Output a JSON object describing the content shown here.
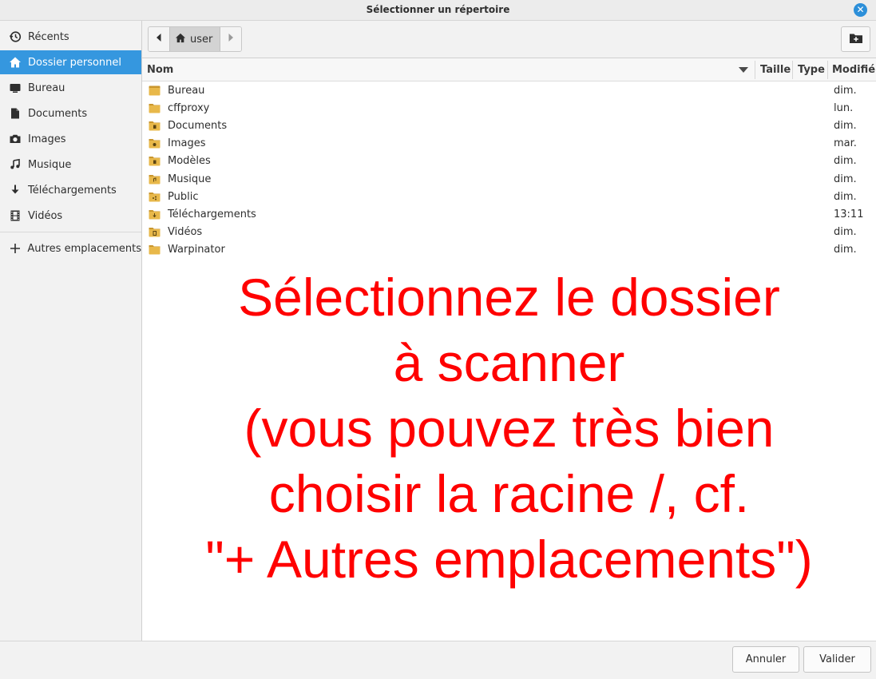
{
  "window": {
    "title": "Sélectionner un répertoire"
  },
  "sidebar": {
    "items": [
      {
        "label": "Récents",
        "icon": "clock-icon"
      },
      {
        "label": "Dossier personnel",
        "icon": "home-icon",
        "active": true
      },
      {
        "label": "Bureau",
        "icon": "desktop-icon"
      },
      {
        "label": "Documents",
        "icon": "document-icon"
      },
      {
        "label": "Images",
        "icon": "camera-icon"
      },
      {
        "label": "Musique",
        "icon": "music-icon"
      },
      {
        "label": "Téléchargements",
        "icon": "download-icon"
      },
      {
        "label": "Vidéos",
        "icon": "video-icon"
      }
    ],
    "other_locations": {
      "label": "Autres emplacements",
      "icon": "plus-icon"
    }
  },
  "pathbar": {
    "crumb": "user",
    "crumb_icon": "home-icon"
  },
  "columns": {
    "name": "Nom",
    "size": "Taille",
    "type": "Type",
    "modified": "Modifié"
  },
  "files": [
    {
      "name": "Bureau",
      "modified": "dim.",
      "icon": "folder-desktop-icon"
    },
    {
      "name": "cffproxy",
      "modified": "lun.",
      "icon": "folder-icon"
    },
    {
      "name": "Documents",
      "modified": "dim.",
      "icon": "folder-documents-icon"
    },
    {
      "name": "Images",
      "modified": "mar.",
      "icon": "folder-pictures-icon"
    },
    {
      "name": "Modèles",
      "modified": "dim.",
      "icon": "folder-templates-icon"
    },
    {
      "name": "Musique",
      "modified": "dim.",
      "icon": "folder-music-icon"
    },
    {
      "name": "Public",
      "modified": "dim.",
      "icon": "folder-public-icon"
    },
    {
      "name": "Téléchargements",
      "modified": "13:11",
      "icon": "folder-download-icon"
    },
    {
      "name": "Vidéos",
      "modified": "dim.",
      "icon": "folder-videos-icon"
    },
    {
      "name": "Warpinator",
      "modified": "dim.",
      "icon": "folder-icon"
    }
  ],
  "annotation": {
    "lines": [
      "Sélectionnez le dossier",
      "à scanner",
      "(vous pouvez très bien",
      "choisir la racine /, cf.",
      "\"+ Autres emplacements\")"
    ],
    "color": "#ff0000"
  },
  "buttons": {
    "cancel": "Annuler",
    "confirm": "Valider"
  },
  "colors": {
    "accent": "#3597df",
    "folder": "#e8b84a",
    "close": "#2c8fd9"
  }
}
